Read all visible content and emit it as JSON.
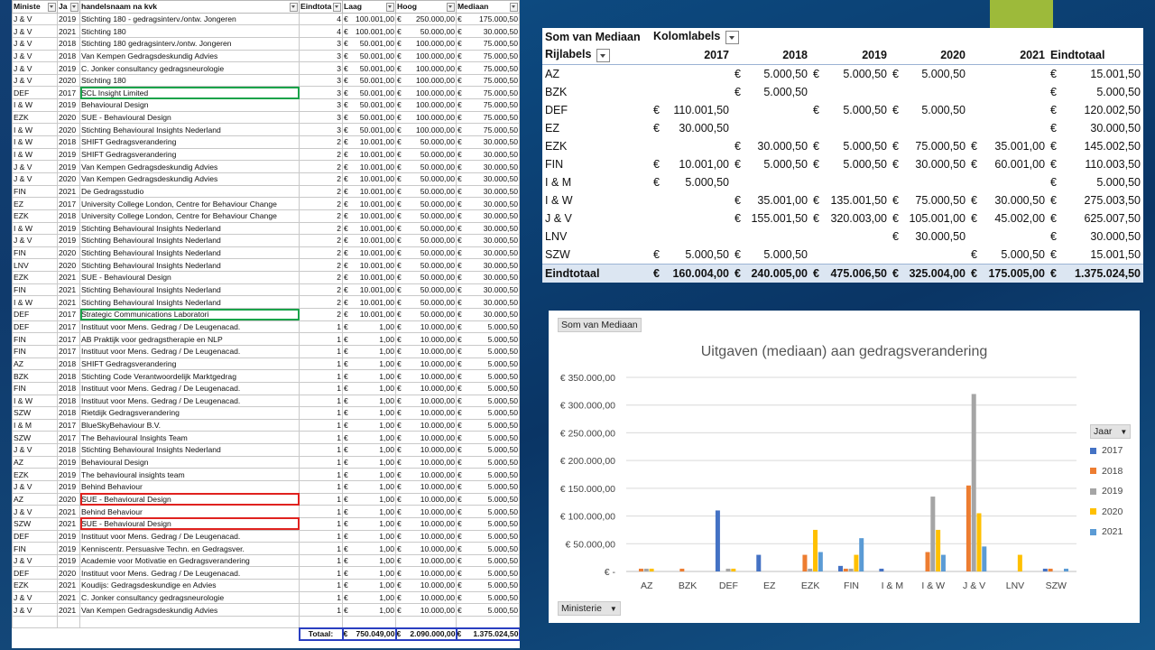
{
  "source_table": {
    "headers": [
      "Ministe",
      "Ja",
      "handelsnaam na kvk",
      "Eindtota",
      "Laag",
      "Hoog",
      "Mediaan"
    ],
    "rows": [
      [
        "J & V",
        "2019",
        "Stichting 180 - gedragsinterv./ontw. Jongeren",
        "4",
        "100.001,00",
        "250.000,00",
        "175.000,50"
      ],
      [
        "J & V",
        "2021",
        "Stichting 180",
        "4",
        "100.001,00",
        "50.000,00",
        "30.000,50"
      ],
      [
        "J & V",
        "2018",
        "Stichting 180  gedragsinterv./ontw. Jongeren",
        "3",
        "50.001,00",
        "100.000,00",
        "75.000,50"
      ],
      [
        "J & V",
        "2018",
        "Van Kempen Gedragsdeskundig Advies",
        "3",
        "50.001,00",
        "100.000,00",
        "75.000,50"
      ],
      [
        "J & V",
        "2019",
        "C. Jonker consultancy gedragsneurologie",
        "3",
        "50.001,00",
        "100.000,00",
        "75.000,50"
      ],
      [
        "J & V",
        "2020",
        "Stichting 180",
        "3",
        "50.001,00",
        "100.000,00",
        "75.000,50"
      ],
      [
        "DEF",
        "2017",
        "SCL Insight Limited",
        "3",
        "50.001,00",
        "100.000,00",
        "75.000,50"
      ],
      [
        "I & W",
        "2019",
        "Behavioural Design",
        "3",
        "50.001,00",
        "100.000,00",
        "75.000,50"
      ],
      [
        "EZK",
        "2020",
        "SUE - Behavioural Design",
        "3",
        "50.001,00",
        "100.000,00",
        "75.000,50"
      ],
      [
        "I & W",
        "2020",
        "Stichting Behavioural Insights Nederland",
        "3",
        "50.001,00",
        "100.000,00",
        "75.000,50"
      ],
      [
        "I & W",
        "2018",
        "SHIFT Gedragsverandering",
        "2",
        "10.001,00",
        "50.000,00",
        "30.000,50"
      ],
      [
        "I & W",
        "2019",
        "SHIFT Gedragsverandering",
        "2",
        "10.001,00",
        "50.000,00",
        "30.000,50"
      ],
      [
        "J & V",
        "2019",
        "Van Kempen Gedragsdeskundig Advies",
        "2",
        "10.001,00",
        "50.000,00",
        "30.000,50"
      ],
      [
        "J & V",
        "2020",
        "Van Kempen Gedragsdeskundig Advies",
        "2",
        "10.001,00",
        "50.000,00",
        "30.000,50"
      ],
      [
        "FIN",
        "2021",
        "De Gedragsstudio",
        "2",
        "10.001,00",
        "50.000,00",
        "30.000,50"
      ],
      [
        "EZ",
        "2017",
        "University College London, Centre for Behaviour Change",
        "2",
        "10.001,00",
        "50.000,00",
        "30.000,50"
      ],
      [
        "EZK",
        "2018",
        "University College London, Centre for Behaviour Change",
        "2",
        "10.001,00",
        "50.000,00",
        "30.000,50"
      ],
      [
        "I & W",
        "2019",
        "Stichting Behavioural Insights Nederland",
        "2",
        "10.001,00",
        "50.000,00",
        "30.000,50"
      ],
      [
        "J & V",
        "2019",
        "Stichting Behavioural Insights Nederland",
        "2",
        "10.001,00",
        "50.000,00",
        "30.000,50"
      ],
      [
        "FIN",
        "2020",
        "Stichting Behavioural Insights Nederland",
        "2",
        "10.001,00",
        "50.000,00",
        "30.000,50"
      ],
      [
        "LNV",
        "2020",
        "Stichting Behavioural Insights Nederland",
        "2",
        "10.001,00",
        "50.000,00",
        "30.000,50"
      ],
      [
        "EZK",
        "2021",
        "SUE - Behavioural Design",
        "2",
        "10.001,00",
        "50.000,00",
        "30.000,50"
      ],
      [
        "FIN",
        "2021",
        "Stichting Behavioural Insights Nederland",
        "2",
        "10.001,00",
        "50.000,00",
        "30.000,50"
      ],
      [
        "I & W",
        "2021",
        "Stichting Behavioural Insights Nederland",
        "2",
        "10.001,00",
        "50.000,00",
        "30.000,50"
      ],
      [
        "DEF",
        "2017",
        "Strategic Communications Laboratori",
        "2",
        "10.001,00",
        "50.000,00",
        "30.000,50"
      ],
      [
        "DEF",
        "2017",
        "Instituut voor Mens. Gedrag / De Leugenacad.",
        "1",
        "1,00",
        "10.000,00",
        "5.000,50"
      ],
      [
        "FIN",
        "2017",
        "AB Praktijk voor gedragstherapie en NLP",
        "1",
        "1,00",
        "10.000,00",
        "5.000,50"
      ],
      [
        "FIN",
        "2017",
        "Instituut voor Mens. Gedrag / De Leugenacad.",
        "1",
        "1,00",
        "10.000,00",
        "5.000,50"
      ],
      [
        "AZ",
        "2018",
        "SHIFT Gedragsverandering",
        "1",
        "1,00",
        "10.000,00",
        "5.000,50"
      ],
      [
        "BZK",
        "2018",
        "Stichting Code Verantwoordelijk Marktgedrag",
        "1",
        "1,00",
        "10.000,00",
        "5.000,50"
      ],
      [
        "FIN",
        "2018",
        "Instituut voor Mens. Gedrag / De Leugenacad.",
        "1",
        "1,00",
        "10.000,00",
        "5.000,50"
      ],
      [
        "I & W",
        "2018",
        "Instituut voor Mens. Gedrag / De Leugenacad.",
        "1",
        "1,00",
        "10.000,00",
        "5.000,50"
      ],
      [
        "SZW",
        "2018",
        "Rietdijk Gedragsverandering",
        "1",
        "1,00",
        "10.000,00",
        "5.000,50"
      ],
      [
        "I & M",
        "2017",
        "BlueSkyBehaviour B.V.",
        "1",
        "1,00",
        "10.000,00",
        "5.000,50"
      ],
      [
        "SZW",
        "2017",
        "The Behavioural Insights Team",
        "1",
        "1,00",
        "10.000,00",
        "5.000,50"
      ],
      [
        "J & V",
        "2018",
        "Stichting Behavioural Insights Nederland",
        "1",
        "1,00",
        "10.000,00",
        "5.000,50"
      ],
      [
        "AZ",
        "2019",
        "Behavioural Design",
        "1",
        "1,00",
        "10.000,00",
        "5.000,50"
      ],
      [
        "EZK",
        "2019",
        "The behavioural insights team",
        "1",
        "1,00",
        "10.000,00",
        "5.000,50"
      ],
      [
        "J & V",
        "2019",
        "Behind Behaviour",
        "1",
        "1,00",
        "10.000,00",
        "5.000,50"
      ],
      [
        "AZ",
        "2020",
        "SUE - Behavioural Design",
        "1",
        "1,00",
        "10.000,00",
        "5.000,50"
      ],
      [
        "J & V",
        "2021",
        "Behind Behaviour",
        "1",
        "1,00",
        "10.000,00",
        "5.000,50"
      ],
      [
        "SZW",
        "2021",
        "SUE - Behavioural Design",
        "1",
        "1,00",
        "10.000,00",
        "5.000,50"
      ],
      [
        "DEF",
        "2019",
        "Instituut voor Mens. Gedrag / De Leugenacad.",
        "1",
        "1,00",
        "10.000,00",
        "5.000,50"
      ],
      [
        "FIN",
        "2019",
        "Kenniscentr. Persuasive Techn. en Gedragsver.",
        "1",
        "1,00",
        "10.000,00",
        "5.000,50"
      ],
      [
        "J & V",
        "2019",
        "Academie voor Motivatie en Gedragsverandering",
        "1",
        "1,00",
        "10.000,00",
        "5.000,50"
      ],
      [
        "DEF",
        "2020",
        "Instituut voor Mens. Gedrag / De Leugenacad.",
        "1",
        "1,00",
        "10.000,00",
        "5.000,50"
      ],
      [
        "EZK",
        "2021",
        "Koudijs: Gedragsdeskundige en Advies",
        "1",
        "1,00",
        "10.000,00",
        "5.000,50"
      ],
      [
        "J & V",
        "2021",
        "C. Jonker consultancy gedragsneurologie",
        "1",
        "1,00",
        "10.000,00",
        "5.000,50"
      ],
      [
        "J & V",
        "2021",
        "Van Kempen Gedragsdeskundig Advies",
        "1",
        "1,00",
        "10.000,00",
        "5.000,50"
      ]
    ],
    "highlight_green_rows": [
      6,
      24
    ],
    "highlight_red_rows": [
      39,
      41
    ],
    "currency": "€",
    "totals": {
      "label": "Totaal:",
      "laag": "750.049,00",
      "hoog": "2.090.000,00",
      "mediaan": "1.375.024,50"
    }
  },
  "pivot": {
    "title": "Som van Mediaan",
    "col_labels": "Kolomlabels",
    "row_labels": "Rijlabels",
    "years": [
      "2017",
      "2018",
      "2019",
      "2020",
      "2021"
    ],
    "grand_label": "Eindtotaal",
    "rows": [
      {
        "name": "AZ",
        "cells": [
          "",
          "5.000,50",
          "5.000,50",
          "5.000,50",
          ""
        ],
        "total": "15.001,50"
      },
      {
        "name": "BZK",
        "cells": [
          "",
          "5.000,50",
          "",
          "",
          ""
        ],
        "total": "5.000,50"
      },
      {
        "name": "DEF",
        "cells": [
          "110.001,50",
          "",
          "5.000,50",
          "5.000,50",
          ""
        ],
        "total": "120.002,50"
      },
      {
        "name": "EZ",
        "cells": [
          "30.000,50",
          "",
          "",
          "",
          ""
        ],
        "total": "30.000,50"
      },
      {
        "name": "EZK",
        "cells": [
          "",
          "30.000,50",
          "5.000,50",
          "75.000,50",
          "35.001,00"
        ],
        "total": "145.002,50"
      },
      {
        "name": "FIN",
        "cells": [
          "10.001,00",
          "5.000,50",
          "5.000,50",
          "30.000,50",
          "60.001,00"
        ],
        "total": "110.003,50"
      },
      {
        "name": "I & M",
        "cells": [
          "5.000,50",
          "",
          "",
          "",
          ""
        ],
        "total": "5.000,50"
      },
      {
        "name": "I & W",
        "cells": [
          "",
          "35.001,00",
          "135.001,50",
          "75.000,50",
          "30.000,50"
        ],
        "total": "275.003,50"
      },
      {
        "name": "J & V",
        "cells": [
          "",
          "155.001,50",
          "320.003,00",
          "105.001,00",
          "45.002,00"
        ],
        "total": "625.007,50"
      },
      {
        "name": "LNV",
        "cells": [
          "",
          "",
          "",
          "30.000,50",
          ""
        ],
        "total": "30.000,50"
      },
      {
        "name": "SZW",
        "cells": [
          "5.000,50",
          "5.000,50",
          "",
          "",
          "5.000,50"
        ],
        "total": "15.001,50"
      }
    ],
    "grand": {
      "cells": [
        "160.004,00",
        "240.005,00",
        "475.006,50",
        "325.004,00",
        "175.005,00"
      ],
      "total": "1.375.024,50"
    }
  },
  "chart_data": {
    "type": "bar",
    "field_button": "Som van Mediaan",
    "title": "Uitgaven (mediaan) aan gedragsverandering",
    "axis_button": "Ministerie",
    "legend_title": "Jaar",
    "categories": [
      "AZ",
      "BZK",
      "DEF",
      "EZ",
      "EZK",
      "FIN",
      "I & M",
      "I & W",
      "J & V",
      "LNV",
      "SZW"
    ],
    "y_ticks": [
      "€ 350.000,00",
      "€ 300.000,00",
      "€ 250.000,00",
      "€ 200.000,00",
      "€ 150.000,00",
      "€ 100.000,00",
      "€ 50.000,00",
      "€ -"
    ],
    "ylim": [
      0,
      350000
    ],
    "grid": true,
    "legend_position": "right",
    "series": [
      {
        "name": "2017",
        "color": "#4472c4",
        "values": [
          0,
          0,
          110001.5,
          30000.5,
          0,
          10001,
          5000.5,
          0,
          0,
          0,
          5000.5
        ]
      },
      {
        "name": "2018",
        "color": "#ed7d31",
        "values": [
          5000.5,
          5000.5,
          0,
          0,
          30000.5,
          5000.5,
          0,
          35001,
          155001.5,
          0,
          5000.5
        ]
      },
      {
        "name": "2019",
        "color": "#a5a5a5",
        "values": [
          5000.5,
          0,
          5000.5,
          0,
          5000.5,
          5000.5,
          0,
          135001.5,
          320003,
          0,
          0
        ]
      },
      {
        "name": "2020",
        "color": "#ffc000",
        "values": [
          5000.5,
          0,
          5000.5,
          0,
          75000.5,
          30000.5,
          0,
          75000.5,
          105001,
          30000.5,
          0
        ]
      },
      {
        "name": "2021",
        "color": "#5b9bd5",
        "values": [
          0,
          0,
          0,
          0,
          35001,
          60001,
          0,
          30000.5,
          45002,
          0,
          5000.5
        ]
      }
    ]
  }
}
